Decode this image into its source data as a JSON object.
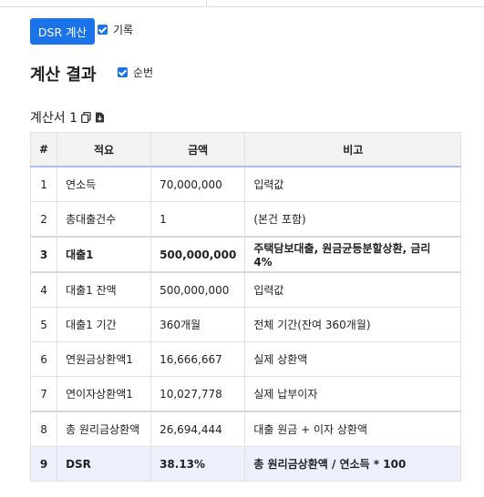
{
  "toolbar": {
    "calc_button": "DSR 계산",
    "record_label": "기록"
  },
  "result": {
    "title": "계산 결과",
    "order_label": "순번",
    "sheet_title": "계산서 1"
  },
  "table": {
    "headers": [
      "#",
      "적요",
      "금액",
      "비고"
    ],
    "rows": [
      {
        "no": "1",
        "item": "연소득",
        "amount": "70,000,000",
        "note": "입력값"
      },
      {
        "no": "2",
        "item": "총대출건수",
        "amount": "1",
        "note": "(본건 포함)"
      },
      {
        "no": "3",
        "item": "대출1",
        "amount": "500,000,000",
        "note": "주택담보대출, 원금균등분할상환, 금리 4%"
      },
      {
        "no": "4",
        "item": "대출1 잔액",
        "amount": "500,000,000",
        "note": "입력값"
      },
      {
        "no": "5",
        "item": "대출1 기간",
        "amount": "360개월",
        "note": "전체 기간(잔여 360개월)"
      },
      {
        "no": "6",
        "item": "연원금상환액1",
        "amount": "16,666,667",
        "note": "실제 상환액"
      },
      {
        "no": "7",
        "item": "연이자상환액1",
        "amount": "10,027,778",
        "note": "실제 납부이자"
      },
      {
        "no": "8",
        "item": "총 원리금상환액",
        "amount": "26,694,444",
        "note": "대출 원금 + 이자 상환액"
      },
      {
        "no": "9",
        "item": "DSR",
        "amount": "38.13%",
        "note": "총 원리금상환액 / 연소득 * 100"
      }
    ]
  },
  "colors": {
    "accent": "#1a73e8",
    "highlight_row": "#edf0fc"
  },
  "icons": [
    "checkbox-checked-icon",
    "copy-icon",
    "download-icon"
  ]
}
